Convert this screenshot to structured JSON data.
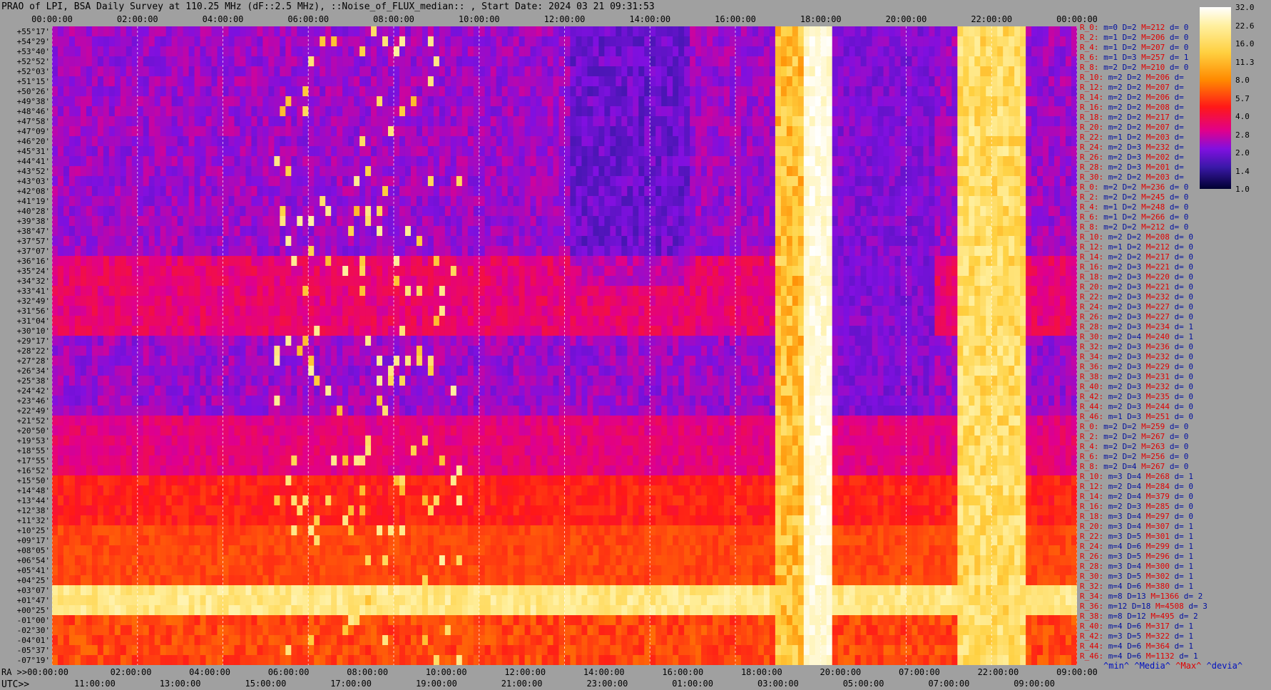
{
  "title": "PRAO of LPI, BSA Daily Survey at 110.25 MHz (dF::2.5 MHz), ::Noise_of_FLUX_median:: , Start Date: 2024 03 21 09:31:53",
  "chart_data": {
    "type": "heatmap",
    "title": "PRAO of LPI, BSA Daily Survey at 110.25 MHz (dF::2.5 MHz), ::Noise_of_FLUX_median:: , Start Date: 2024 03 21 09:31:53",
    "x_top_labels": [
      "00:00:00",
      "02:00:00",
      "04:00:00",
      "06:00:00",
      "08:00:00",
      "10:00:00",
      "12:00:00",
      "14:00:00",
      "16:00:00",
      "18:00:00",
      "20:00:00",
      "22:00:00",
      "00:00:00"
    ],
    "x_bottom_ra_labels": [
      "RA >>00:00:00",
      "02:00:00",
      "04:00:00",
      "06:00:00",
      "08:00:00",
      "10:00:00",
      "12:00:00",
      "14:00:00",
      "16:00:00",
      "18:00:00",
      "20:00:00",
      "07:00:00",
      "22:00:00",
      "09:00:00"
    ],
    "x_bottom_utc_prefix": "UTC>>",
    "x_bottom_utc_labels": [
      "11:00:00",
      "13:00:00",
      "15:00:00",
      "17:00:00",
      "19:00:00",
      "21:00:00",
      "23:00:00",
      "01:00:00",
      "03:00:00",
      "05:00:00",
      "07:00:00",
      "09:00:00"
    ],
    "y_labels": [
      "+55°17'",
      "+54°29'",
      "+53°40'",
      "+52°52'",
      "+52°03'",
      "+51°15'",
      "+50°26'",
      "+49°38'",
      "+48°46'",
      "+47°58'",
      "+47°09'",
      "+46°20'",
      "+45°31'",
      "+44°41'",
      "+43°52'",
      "+43°03'",
      "+42°08'",
      "+41°19'",
      "+40°28'",
      "+39°38'",
      "+38°47'",
      "+37°57'",
      "+37°07'",
      "+36°16'",
      "+35°24'",
      "+34°32'",
      "+33°41'",
      "+32°49'",
      "+31°56'",
      "+31°04'",
      "+30°10'",
      "+29°17'",
      "+28°22'",
      "+27°28'",
      "+26°34'",
      "+25°38'",
      "+24°42'",
      "+23°46'",
      "+22°49'",
      "+21°52'",
      "+20°50'",
      "+19°53'",
      "+18°55'",
      "+17°55'",
      "+16°52'",
      "+15°50'",
      "+14°48'",
      "+13°44'",
      "+12°38'",
      "+11°32'",
      "+10°25'",
      "+09°17'",
      "+08°05'",
      "+06°54'",
      "+05°41'",
      "+04°25'",
      "+03°07'",
      "+01°47'",
      "+00°25'",
      "-01°00'",
      "-02°30'",
      "-04°01'",
      "-05°37'",
      "-07°19'"
    ],
    "colorbar": {
      "ticks": [
        "32.0",
        "22.6",
        "16.0",
        "11.3",
        "8.0",
        "5.7",
        "4.0",
        "2.8",
        "2.0",
        "1.4",
        "1.0"
      ],
      "range": [
        1.0,
        32.0
      ],
      "scale": "log"
    },
    "row_stats": [
      {
        "r": "R_0:",
        "m": "m=0",
        "d": "D=2",
        "h": "M=212",
        "dv": "d= 0"
      },
      {
        "r": "R_2:",
        "m": "m=1",
        "d": "D=2",
        "h": "M=206",
        "dv": "d= 0"
      },
      {
        "r": "R_4:",
        "m": "m=1",
        "d": "D=2",
        "h": "M=207",
        "dv": "d= 0"
      },
      {
        "r": "R_6:",
        "m": "m=1",
        "d": "D=3",
        "h": "M=257",
        "dv": "d= 1"
      },
      {
        "r": "R_8:",
        "m": "m=2",
        "d": "D=2",
        "h": "M=210",
        "dv": "d= 0"
      },
      {
        "r": "R_10:",
        "m": "m=2",
        "d": "D=2",
        "h": "M=206",
        "dv": "d="
      },
      {
        "r": "R_12:",
        "m": "m=2",
        "d": "D=2",
        "h": "M=207",
        "dv": "d="
      },
      {
        "r": "R_14:",
        "m": "m=2",
        "d": "D=2",
        "h": "M=206",
        "dv": "d="
      },
      {
        "r": "R_16:",
        "m": "m=2",
        "d": "D=2",
        "h": "M=208",
        "dv": "d="
      },
      {
        "r": "R_18:",
        "m": "m=2",
        "d": "D=2",
        "h": "M=217",
        "dv": "d="
      },
      {
        "r": "R_20:",
        "m": "m=2",
        "d": "D=2",
        "h": "M=207",
        "dv": "d="
      },
      {
        "r": "R_22:",
        "m": "m=1",
        "d": "D=2",
        "h": "M=203",
        "dv": "d="
      },
      {
        "r": "R_24:",
        "m": "m=2",
        "d": "D=3",
        "h": "M=232",
        "dv": "d="
      },
      {
        "r": "R_26:",
        "m": "m=2",
        "d": "D=3",
        "h": "M=202",
        "dv": "d="
      },
      {
        "r": "R_28:",
        "m": "m=2",
        "d": "D=3",
        "h": "M=201",
        "dv": "d="
      },
      {
        "r": "R_30:",
        "m": "m=2",
        "d": "D=2",
        "h": "M=203",
        "dv": "d="
      },
      {
        "r": "R_0:",
        "m": "m=2",
        "d": "D=2",
        "h": "M=236",
        "dv": "d= 0"
      },
      {
        "r": "R_2:",
        "m": "m=2",
        "d": "D=2",
        "h": "M=245",
        "dv": "d= 0"
      },
      {
        "r": "R_4:",
        "m": "m=1",
        "d": "D=2",
        "h": "M=248",
        "dv": "d= 0"
      },
      {
        "r": "R_6:",
        "m": "m=1",
        "d": "D=2",
        "h": "M=266",
        "dv": "d= 0"
      },
      {
        "r": "R_8:",
        "m": "m=2",
        "d": "D=2",
        "h": "M=212",
        "dv": "d= 0"
      },
      {
        "r": "R_10:",
        "m": "m=2",
        "d": "D=2",
        "h": "M=208",
        "dv": "d= 0"
      },
      {
        "r": "R_12:",
        "m": "m=1",
        "d": "D=2",
        "h": "M=212",
        "dv": "d= 0"
      },
      {
        "r": "R_14:",
        "m": "m=2",
        "d": "D=2",
        "h": "M=217",
        "dv": "d= 0"
      },
      {
        "r": "R_16:",
        "m": "m=2",
        "d": "D=3",
        "h": "M=221",
        "dv": "d= 0"
      },
      {
        "r": "R_18:",
        "m": "m=2",
        "d": "D=3",
        "h": "M=220",
        "dv": "d= 0"
      },
      {
        "r": "R_20:",
        "m": "m=2",
        "d": "D=3",
        "h": "M=221",
        "dv": "d= 0"
      },
      {
        "r": "R_22:",
        "m": "m=2",
        "d": "D=3",
        "h": "M=232",
        "dv": "d= 0"
      },
      {
        "r": "R_24:",
        "m": "m=2",
        "d": "D=3",
        "h": "M=227",
        "dv": "d= 0"
      },
      {
        "r": "R_26:",
        "m": "m=2",
        "d": "D=3",
        "h": "M=227",
        "dv": "d= 0"
      },
      {
        "r": "R_28:",
        "m": "m=2",
        "d": "D=3",
        "h": "M=234",
        "dv": "d= 1"
      },
      {
        "r": "R_30:",
        "m": "m=2",
        "d": "D=4",
        "h": "M=240",
        "dv": "d= 1"
      },
      {
        "r": "R_32:",
        "m": "m=2",
        "d": "D=3",
        "h": "M=236",
        "dv": "d= 0"
      },
      {
        "r": "R_34:",
        "m": "m=2",
        "d": "D=3",
        "h": "M=232",
        "dv": "d= 0"
      },
      {
        "r": "R_36:",
        "m": "m=2",
        "d": "D=3",
        "h": "M=229",
        "dv": "d= 0"
      },
      {
        "r": "R_38:",
        "m": "m=2",
        "d": "D=3",
        "h": "M=231",
        "dv": "d= 0"
      },
      {
        "r": "R_40:",
        "m": "m=2",
        "d": "D=3",
        "h": "M=232",
        "dv": "d= 0"
      },
      {
        "r": "R_42:",
        "m": "m=2",
        "d": "D=3",
        "h": "M=235",
        "dv": "d= 0"
      },
      {
        "r": "R_44:",
        "m": "m=2",
        "d": "D=3",
        "h": "M=244",
        "dv": "d= 0"
      },
      {
        "r": "R_46:",
        "m": "m=1",
        "d": "D=3",
        "h": "M=251",
        "dv": "d= 0"
      },
      {
        "r": "R_0:",
        "m": "m=2",
        "d": "D=2",
        "h": "M=259",
        "dv": "d= 0"
      },
      {
        "r": "R_2:",
        "m": "m=2",
        "d": "D=2",
        "h": "M=267",
        "dv": "d= 0"
      },
      {
        "r": "R_4:",
        "m": "m=2",
        "d": "D=2",
        "h": "M=263",
        "dv": "d= 0"
      },
      {
        "r": "R_6:",
        "m": "m=2",
        "d": "D=2",
        "h": "M=256",
        "dv": "d= 0"
      },
      {
        "r": "R_8:",
        "m": "m=2",
        "d": "D=4",
        "h": "M=267",
        "dv": "d= 0"
      },
      {
        "r": "R_10:",
        "m": "m=3",
        "d": "D=4",
        "h": "M=268",
        "dv": "d= 1"
      },
      {
        "r": "R_12:",
        "m": "m=2",
        "d": "D=4",
        "h": "M=284",
        "dv": "d= 0"
      },
      {
        "r": "R_14:",
        "m": "m=2",
        "d": "D=4",
        "h": "M=379",
        "dv": "d= 0"
      },
      {
        "r": "R_16:",
        "m": "m=2",
        "d": "D=3",
        "h": "M=285",
        "dv": "d= 0"
      },
      {
        "r": "R_18:",
        "m": "m=3",
        "d": "D=4",
        "h": "M=297",
        "dv": "d= 0"
      },
      {
        "r": "R_20:",
        "m": "m=3",
        "d": "D=4",
        "h": "M=307",
        "dv": "d= 1"
      },
      {
        "r": "R_22:",
        "m": "m=3",
        "d": "D=5",
        "h": "M=301",
        "dv": "d= 1"
      },
      {
        "r": "R_24:",
        "m": "m=4",
        "d": "D=6",
        "h": "M=299",
        "dv": "d= 1"
      },
      {
        "r": "R_26:",
        "m": "m=3",
        "d": "D=5",
        "h": "M=296",
        "dv": "d= 1"
      },
      {
        "r": "R_28:",
        "m": "m=3",
        "d": "D=4",
        "h": "M=300",
        "dv": "d= 1"
      },
      {
        "r": "R_30:",
        "m": "m=3",
        "d": "D=5",
        "h": "M=302",
        "dv": "d= 1"
      },
      {
        "r": "R_32:",
        "m": "m=4",
        "d": "D=6",
        "h": "M=380",
        "dv": "d= 1"
      },
      {
        "r": "R_34:",
        "m": "m=8",
        "d": "D=13",
        "h": "M=1366",
        "dv": "d= 2"
      },
      {
        "r": "R_36:",
        "m": "m=12",
        "d": "D=18",
        "h": "M=4508",
        "dv": "d= 3"
      },
      {
        "r": "R_38:",
        "m": "m=8",
        "d": "D=12",
        "h": "M=495",
        "dv": "d= 2"
      },
      {
        "r": "R_40:",
        "m": "m=4",
        "d": "D=6",
        "h": "M=317",
        "dv": "d= 1"
      },
      {
        "r": "R_42:",
        "m": "m=3",
        "d": "D=5",
        "h": "M=322",
        "dv": "d= 1"
      },
      {
        "r": "R_44:",
        "m": "m=4",
        "d": "D=6",
        "h": "M=364",
        "dv": "d= 1"
      },
      {
        "r": "R_46:",
        "m": "m=4",
        "d": "D=6",
        "h": "M=1132",
        "dv": "d= 1"
      }
    ],
    "legend": {
      "min": "^min^",
      "median": "^Media^",
      "max": "^Max^",
      "dev": "^devia^"
    }
  }
}
